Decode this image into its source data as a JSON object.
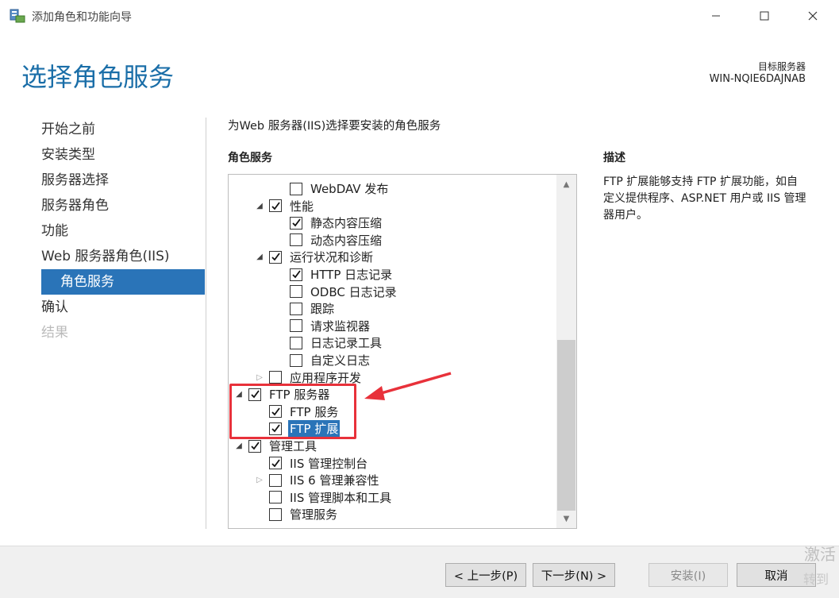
{
  "window": {
    "title": "添加角色和功能向导",
    "icon": "server-manager-icon"
  },
  "header": {
    "page_title": "选择角色服务",
    "target_label": "目标服务器",
    "target_value": "WIN-NQIE6DAJNAB"
  },
  "nav": {
    "items": [
      {
        "label": "开始之前",
        "state": "normal"
      },
      {
        "label": "安装类型",
        "state": "normal"
      },
      {
        "label": "服务器选择",
        "state": "normal"
      },
      {
        "label": "服务器角色",
        "state": "normal"
      },
      {
        "label": "功能",
        "state": "normal"
      },
      {
        "label": "Web 服务器角色(IIS)",
        "state": "normal"
      },
      {
        "label": "角色服务",
        "state": "active"
      },
      {
        "label": "确认",
        "state": "normal"
      },
      {
        "label": "结果",
        "state": "disabled"
      }
    ]
  },
  "main": {
    "instruction": "为Web 服务器(IIS)选择要安装的角色服务",
    "roles_title": "角色服务",
    "description_title": "描述",
    "description": "FTP 扩展能够支持 FTP 扩展功能，如自定义提供程序、ASP.NET 用户或 IIS 管理器用户。"
  },
  "tree": [
    {
      "label": "WebDAV 发布",
      "level": 2,
      "expander": "",
      "checked": false,
      "selected": false
    },
    {
      "label": "性能",
      "level": 1,
      "expander": "expanded",
      "checked": true,
      "selected": false
    },
    {
      "label": "静态内容压缩",
      "level": 2,
      "expander": "",
      "checked": true,
      "selected": false
    },
    {
      "label": "动态内容压缩",
      "level": 2,
      "expander": "",
      "checked": false,
      "selected": false
    },
    {
      "label": "运行状况和诊断",
      "level": 1,
      "expander": "expanded",
      "checked": true,
      "selected": false
    },
    {
      "label": "HTTP 日志记录",
      "level": 2,
      "expander": "",
      "checked": true,
      "selected": false
    },
    {
      "label": "ODBC 日志记录",
      "level": 2,
      "expander": "",
      "checked": false,
      "selected": false
    },
    {
      "label": "跟踪",
      "level": 2,
      "expander": "",
      "checked": false,
      "selected": false
    },
    {
      "label": "请求监视器",
      "level": 2,
      "expander": "",
      "checked": false,
      "selected": false
    },
    {
      "label": "日志记录工具",
      "level": 2,
      "expander": "",
      "checked": false,
      "selected": false
    },
    {
      "label": "自定义日志",
      "level": 2,
      "expander": "",
      "checked": false,
      "selected": false
    },
    {
      "label": "应用程序开发",
      "level": 1,
      "expander": "collapsed",
      "checked": false,
      "selected": false
    },
    {
      "label": "FTP 服务器",
      "level": 0,
      "expander": "expanded",
      "checked": true,
      "selected": false
    },
    {
      "label": "FTP 服务",
      "level": 1,
      "expander": "",
      "checked": true,
      "selected": false
    },
    {
      "label": "FTP 扩展",
      "level": 1,
      "expander": "",
      "checked": true,
      "selected": true
    },
    {
      "label": "管理工具",
      "level": 0,
      "expander": "expanded",
      "checked": true,
      "selected": false
    },
    {
      "label": "IIS 管理控制台",
      "level": 1,
      "expander": "",
      "checked": true,
      "selected": false
    },
    {
      "label": "IIS 6 管理兼容性",
      "level": 1,
      "expander": "collapsed",
      "checked": false,
      "selected": false
    },
    {
      "label": "IIS 管理脚本和工具",
      "level": 1,
      "expander": "",
      "checked": false,
      "selected": false
    },
    {
      "label": "管理服务",
      "level": 1,
      "expander": "",
      "checked": false,
      "selected": false
    }
  ],
  "footer": {
    "prev_label": "< 上一步(P)",
    "next_label": "下一步(N) >",
    "install_label": "安装(I)",
    "cancel_label": "取消"
  },
  "watermark": {
    "line1": "激活",
    "line2": "转到"
  },
  "colors": {
    "accent": "#2a74b8",
    "title": "#1a6ea8",
    "annotation": "#e8313a"
  }
}
